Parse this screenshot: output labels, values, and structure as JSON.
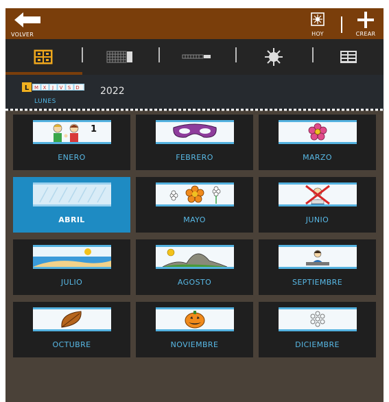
{
  "topbar": {
    "back_label": "VOLVER",
    "today_label": "HOY",
    "create_label": "CREAR",
    "color": "#7a3e0b"
  },
  "viewbar": {
    "tabs": [
      {
        "icon": "month-grid-icon",
        "selected": true
      },
      {
        "icon": "calendar-grid-icon",
        "selected": false
      },
      {
        "icon": "week-strip-icon",
        "selected": false
      },
      {
        "icon": "sun-icon",
        "selected": false
      },
      {
        "icon": "list-view-icon",
        "selected": false
      }
    ]
  },
  "date_header": {
    "day_letters": [
      "L",
      "M",
      "X",
      "J",
      "V",
      "S",
      "D"
    ],
    "day_name": "LUNES",
    "year": "2022"
  },
  "months": [
    {
      "name": "ENERO",
      "icon": "children-one-icon",
      "badge": "1"
    },
    {
      "name": "FEBRERO",
      "icon": "carnival-mask-icon"
    },
    {
      "name": "MARZO",
      "icon": "flower-icon"
    },
    {
      "name": "ABRIL",
      "icon": "rain-icon",
      "selected": true
    },
    {
      "name": "MAYO",
      "icon": "flowers-icon"
    },
    {
      "name": "JUNIO",
      "icon": "no-school-icon"
    },
    {
      "name": "JULIO",
      "icon": "beach-icon"
    },
    {
      "name": "AGOSTO",
      "icon": "mountain-icon"
    },
    {
      "name": "SEPTIEMBRE",
      "icon": "student-desk-icon"
    },
    {
      "name": "OCTUBRE",
      "icon": "leaf-icon"
    },
    {
      "name": "NOVIEMBRE",
      "icon": "pumpkin-icon"
    },
    {
      "name": "DICIEMBRE",
      "icon": "snowflake-icon"
    }
  ],
  "colors": {
    "accent_blue": "#54b2e0",
    "selected_tile": "#1e8bc3",
    "tile_bg": "#1f1f1f",
    "page_bg": "#4a4138"
  }
}
